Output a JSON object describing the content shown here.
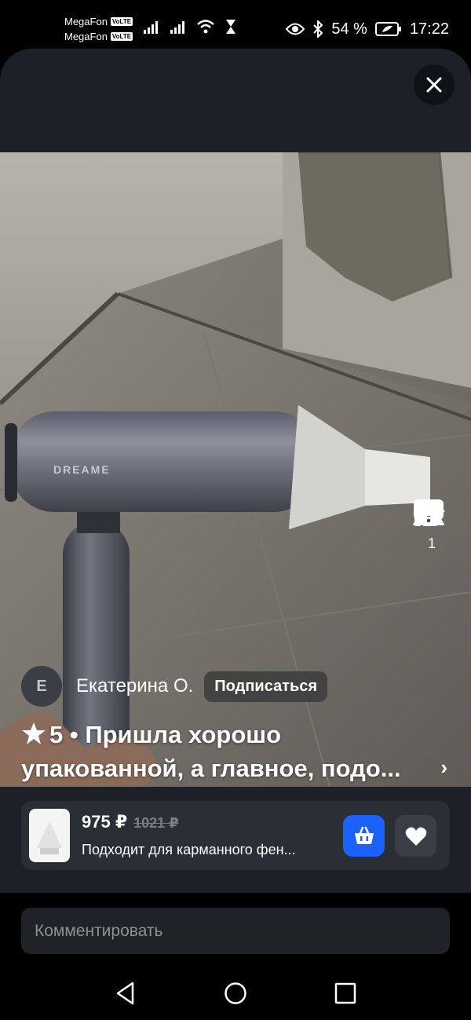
{
  "status_bar": {
    "carrier_1": "MegaFon",
    "carrier_2": "MegaFon",
    "volte": "VoLTE",
    "battery": "54 %",
    "time": "17:22"
  },
  "photo": {
    "brand_print": "DREAME"
  },
  "actions": {
    "likes_count": "1"
  },
  "author": {
    "avatar_letter": "Е",
    "name": "Екатерина О.",
    "subscribe_label": "Подписаться"
  },
  "review": {
    "rating": "5",
    "line1": "5 • Пришла хорошо",
    "line2": "упакованной, а главное, подо..."
  },
  "product": {
    "price": "975 ₽",
    "old_price": "1021 ₽",
    "title": "Подходит для карманного фен..."
  },
  "comment": {
    "placeholder": "Комментировать"
  },
  "colors": {
    "sheet_bg": "#1c2128",
    "card_bg": "#2a2f36",
    "cart_blue": "#1a63ff"
  }
}
